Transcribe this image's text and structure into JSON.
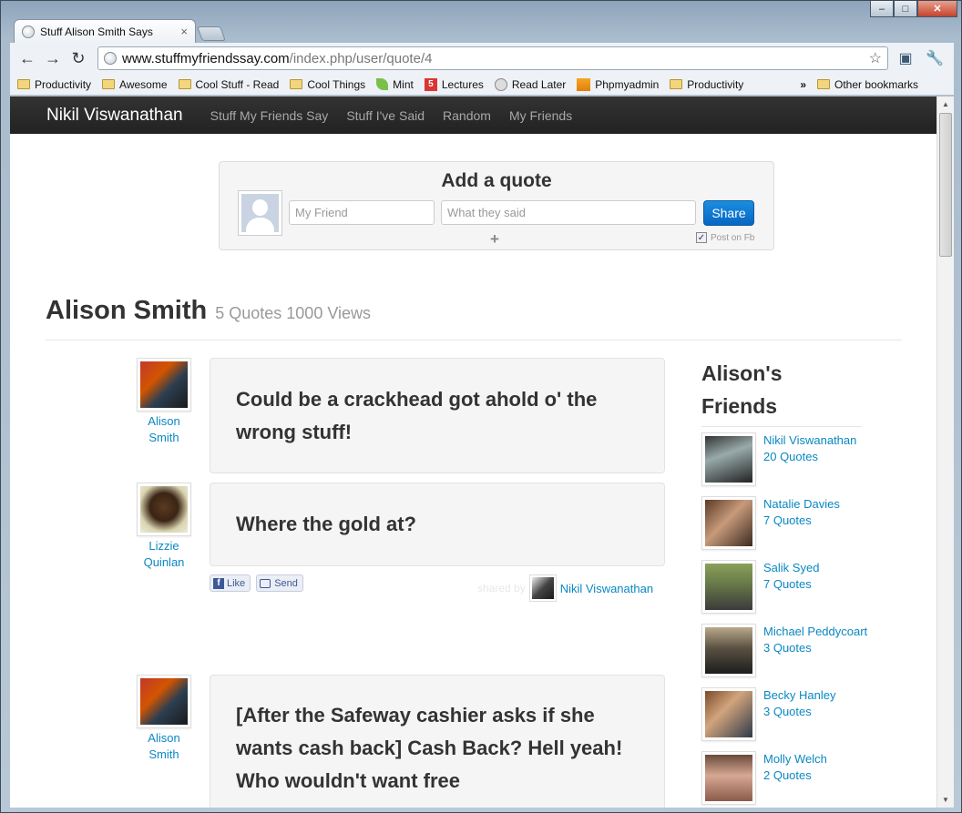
{
  "browser": {
    "tab_title": "Stuff Alison Smith Says",
    "url_domain": "www.stuffmyfriendssay.com",
    "url_path": "/index.php/user/quote/4",
    "bookmarks": [
      {
        "label": "Productivity",
        "icon": "folder-icon"
      },
      {
        "label": "Awesome",
        "icon": "folder-icon"
      },
      {
        "label": "Cool Stuff - Read",
        "icon": "folder-icon"
      },
      {
        "label": "Cool Things",
        "icon": "folder-icon"
      },
      {
        "label": "Mint",
        "icon": "mint-leaf-icon"
      },
      {
        "label": "Lectures",
        "icon": "lectures-icon"
      },
      {
        "label": "Read Later",
        "icon": "globe-icon"
      },
      {
        "label": "Phpmyadmin",
        "icon": "phpmyadmin-icon"
      },
      {
        "label": "Productivity",
        "icon": "folder-icon"
      }
    ],
    "bookmarks_overflow": "»",
    "other_bookmarks": "Other bookmarks"
  },
  "site": {
    "brand": "Nikil Viswanathan",
    "nav": [
      "Stuff My Friends Say",
      "Stuff I've Said",
      "Random",
      "My Friends"
    ]
  },
  "add_quote": {
    "title": "Add a quote",
    "friend_placeholder": "My Friend",
    "quote_placeholder": "What they said",
    "share_label": "Share",
    "post_on_fb_label": "Post on Fb",
    "post_on_fb_checked": true
  },
  "profile": {
    "name": "Alison Smith",
    "meta": "5 Quotes 1000 Views"
  },
  "quotes": [
    {
      "user_first": "Alison",
      "user_last": "Smith",
      "text": "Could be a crackhead got ahold o' the wrong stuff!"
    },
    {
      "user_first": "Lizzie",
      "user_last": "Quinlan",
      "text": "Where the gold at?",
      "like_label": "Like",
      "send_label": "Send",
      "shared_by_label": "shared by",
      "shared_by_name": "Nikil Viswanathan"
    },
    {
      "user_first": "Alison",
      "user_last": "Smith",
      "text": "[After the Safeway cashier asks if she wants cash back] Cash Back? Hell yeah! Who wouldn't want free"
    }
  ],
  "friends": {
    "title": "Alison's Friends",
    "list": [
      {
        "name": "Nikil Viswanathan",
        "count": "20 Quotes"
      },
      {
        "name": "Natalie Davies",
        "count": "7 Quotes"
      },
      {
        "name": "Salik Syed",
        "count": "7 Quotes"
      },
      {
        "name": "Michael Peddycoart",
        "count": "3 Quotes"
      },
      {
        "name": "Becky Hanley",
        "count": "3 Quotes"
      },
      {
        "name": "Molly Welch",
        "count": "2 Quotes"
      }
    ]
  },
  "colors": {
    "link": "#0a88c2",
    "topbar": "#222222",
    "share_button": "#0766c2",
    "quote_box": "#f5f5f5"
  }
}
